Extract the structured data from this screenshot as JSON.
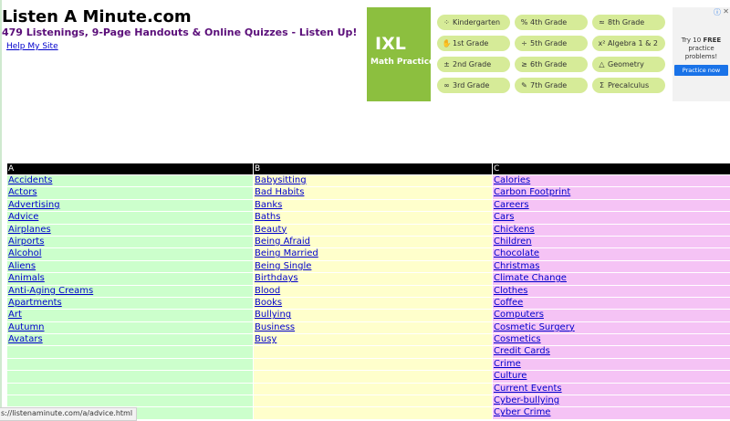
{
  "header": {
    "title": "Listen A Minute.com",
    "subtitle": "479 Listenings, 9-Page Handouts & Online Quizzes - Listen Up!",
    "help_link": "Help My Site"
  },
  "ad": {
    "brand": "IXL",
    "tagline": "Math Practice",
    "grades": [
      {
        "label": "Kindergarten",
        "icon": "dots-icon"
      },
      {
        "label": "4th Grade",
        "icon": "percent-icon"
      },
      {
        "label": "8th Grade",
        "icon": "approx-icon"
      },
      {
        "label": "1st Grade",
        "icon": "hand-icon"
      },
      {
        "label": "5th Grade",
        "icon": "divide-icon"
      },
      {
        "label": "Algebra 1 & 2",
        "icon": "x-squared-icon"
      },
      {
        "label": "2nd Grade",
        "icon": "plus-minus-icon"
      },
      {
        "label": "6th Grade",
        "icon": "greater-equal-icon"
      },
      {
        "label": "Geometry",
        "icon": "triangle-icon"
      },
      {
        "label": "3rd Grade",
        "icon": "infinity-icon"
      },
      {
        "label": "7th Grade",
        "icon": "pencil-icon"
      },
      {
        "label": "Precalculus",
        "icon": "sigma-icon"
      }
    ],
    "side_text_1": "Try 10",
    "side_text_2": "FREE",
    "side_text_3": "practice problems!",
    "cta": "Practice now"
  },
  "table": {
    "columns": [
      {
        "letter": "A",
        "items": [
          "Accidents",
          "Actors",
          "Advertising",
          "Advice",
          "Airplanes",
          "Airports",
          "Alcohol",
          "Aliens",
          "Animals",
          "Anti-Aging Creams",
          "Apartments",
          "Art",
          "Autumn",
          "Avatars",
          "",
          "",
          "",
          "",
          "",
          ""
        ]
      },
      {
        "letter": "B",
        "items": [
          "Babysitting",
          "Bad Habits",
          "Banks",
          "Baths",
          "Beauty",
          "Being Afraid",
          "Being Married",
          "Being Single",
          "Birthdays",
          "Blood",
          "Books",
          "Bullying",
          "Business",
          "Busy",
          "",
          "",
          "",
          "",
          "",
          ""
        ]
      },
      {
        "letter": "C",
        "items": [
          "Calories",
          "Carbon Footprint",
          "Careers",
          "Cars",
          "Chickens",
          "Children",
          "Chocolate",
          "Christmas",
          "Climate Change",
          "Clothes",
          "Coffee",
          "Computers",
          "Cosmetic Surgery",
          "Cosmetics",
          "Credit Cards",
          "Crime",
          "Culture",
          "Current Events",
          "Cyber-bullying",
          "Cyber Crime"
        ]
      }
    ]
  },
  "status_bar": {
    "url": "s://listenaminute.com/a/advice.html"
  },
  "colors": {
    "col_a": "#ccffcc",
    "col_b": "#ffffcc",
    "col_c": "#f5c3f5",
    "link": "#0000cc",
    "subtitle": "#5b0f7a",
    "ixl_green": "#8cbf3f",
    "pill": "#d6eb98"
  }
}
